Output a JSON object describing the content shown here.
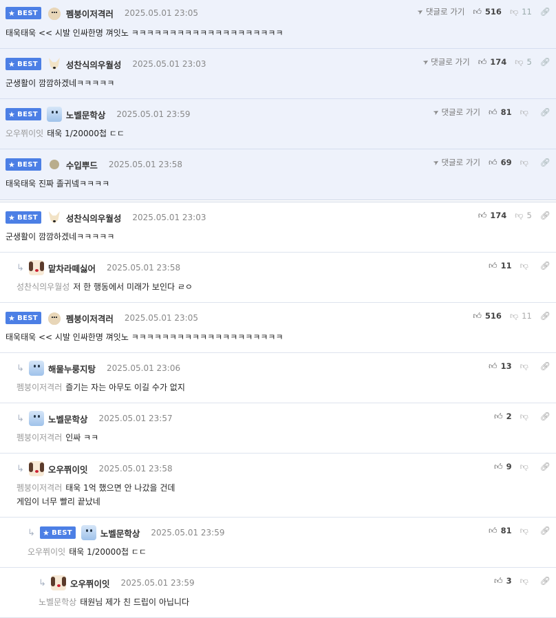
{
  "labels": {
    "best": "BEST",
    "goto_reply": "댓글로 가기"
  },
  "icons": {
    "best_star": "star-icon",
    "goto": "send-icon",
    "upvote": "thumbs-up-icon",
    "downvote": "thumbs-down-icon",
    "link": "link-icon",
    "reply": "reply-arrow-icon"
  },
  "colors": {
    "best_badge": "#4c7fe5",
    "best_background": "#eef2fb",
    "mention": "#999999"
  },
  "best_comments": [
    {
      "nick": "펨붕이저격러",
      "date": "2025.05.01 23:05",
      "mention": "",
      "text": "태욱태욱 << 시발 인싸한명 껴잇노 ㅋㅋㅋㅋㅋㅋㅋㅋㅋㅋㅋㅋㅋㅋㅋㅋㅋㅋㅋㅋ",
      "up": "516",
      "down": "11"
    },
    {
      "nick": "성찬식의우월성",
      "date": "2025.05.01 23:03",
      "mention": "",
      "text": "군생활이 깜깜하겠네ㅋㅋㅋㅋㅋ",
      "up": "174",
      "down": "5"
    },
    {
      "nick": "노벨문학상",
      "date": "2025.05.01 23:59",
      "mention": "오우쮜이잇",
      "text": "태욱 1/20000첩 ㄷㄷ",
      "up": "81",
      "down": ""
    },
    {
      "nick": "수입뿌드",
      "date": "2025.05.01 23:58",
      "mention": "",
      "text": "태욱태욱 진짜 졸귀넼ㅋㅋㅋㅋ",
      "up": "69",
      "down": ""
    }
  ],
  "comments": [
    {
      "nick": "성찬식의우월성",
      "date": "2025.05.01 23:03",
      "mention": "",
      "text": "군생활이 깜깜하겠네ㅋㅋㅋㅋㅋ",
      "up": "174",
      "down": "5"
    },
    {
      "nick": "맡차라떼싫어",
      "date": "2025.05.01 23:58",
      "mention": "성찬식의우월성",
      "text": "저 한 행동에서 미래가 보인다 ㄹㅇ",
      "up": "11",
      "down": ""
    },
    {
      "nick": "펨붕이저격러",
      "date": "2025.05.01 23:05",
      "mention": "",
      "text": "태욱태욱 << 시발 인싸한명 껴잇노 ㅋㅋㅋㅋㅋㅋㅋㅋㅋㅋㅋㅋㅋㅋㅋㅋㅋㅋㅋㅋ",
      "up": "516",
      "down": "11"
    },
    {
      "nick": "해물누룽지탕",
      "date": "2025.05.01 23:06",
      "mention": "펨붕이저격러",
      "text": "즐기는 자는 아무도 이길 수가 없지",
      "up": "13",
      "down": ""
    },
    {
      "nick": "노벨문학상",
      "date": "2025.05.01 23:57",
      "mention": "펨붕이저격러",
      "text": "인싸 ㅋㅋ",
      "up": "2",
      "down": ""
    },
    {
      "nick": "오우쮜이잇",
      "date": "2025.05.01 23:58",
      "mention": "펨붕이저격러",
      "text": "태욱 1억 했으면 안 나갔을 건데",
      "text2": "게임이 너무 빨리 끝났네",
      "up": "9",
      "down": ""
    },
    {
      "nick": "노벨문학상",
      "date": "2025.05.01 23:59",
      "mention": "오우쮜이잇",
      "text": "태욱 1/20000첩 ㄷㄷ",
      "up": "81",
      "down": ""
    },
    {
      "nick": "오우쮜이잇",
      "date": "2025.05.01 23:59",
      "mention": "노벨문학상",
      "text": "태원님 제가 친 드립이 아닙니다",
      "up": "3",
      "down": ""
    }
  ]
}
